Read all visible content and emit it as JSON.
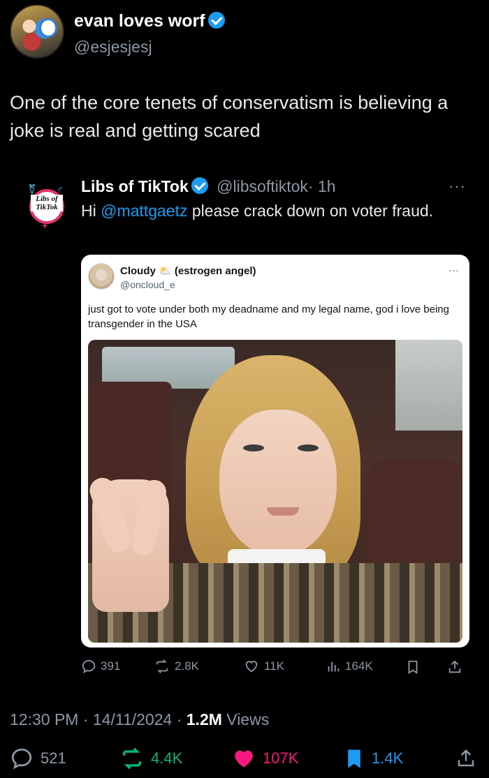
{
  "author": {
    "display_name": "evan loves worf",
    "handle": "@esjesjesj",
    "verified": true
  },
  "tweet_text": "One of the core tenets of conservatism is believing a joke is real and getting scared",
  "quoted": {
    "name": "Libs of TikTok",
    "handle": "@libsoftiktok",
    "time": "· 1h",
    "avatar_logo_text": "Libs of TikTok",
    "text_pre": "Hi ",
    "mention": "@mattgaetz",
    "text_post": " please crack down on voter fraud.",
    "more": "···",
    "embedded": {
      "name": "Cloudy",
      "name_emoji": "⛅",
      "name_suffix": "(estrogen angel)",
      "handle": "@oncloud_e",
      "text": "just got to vote under both my deadname and my legal name, god i love being transgender in the USA",
      "more": "···"
    },
    "stats": {
      "replies": "391",
      "reposts": "2.8K",
      "likes": "11K",
      "views": "164K"
    }
  },
  "meta": {
    "time": "12:30 PM",
    "sep1": " · ",
    "date": "14/11/2024",
    "sep2": " · ",
    "views": "1.2M",
    "views_label": " Views"
  },
  "stats": {
    "replies": "521",
    "reposts": "4.4K",
    "likes": "107K",
    "bookmarks": "1.4K"
  },
  "colors": {
    "background": "#000000",
    "accent": "#1d9bf0",
    "muted": "#8b98a5",
    "repost_active": "#00ba7c",
    "like_active": "#f91880"
  }
}
